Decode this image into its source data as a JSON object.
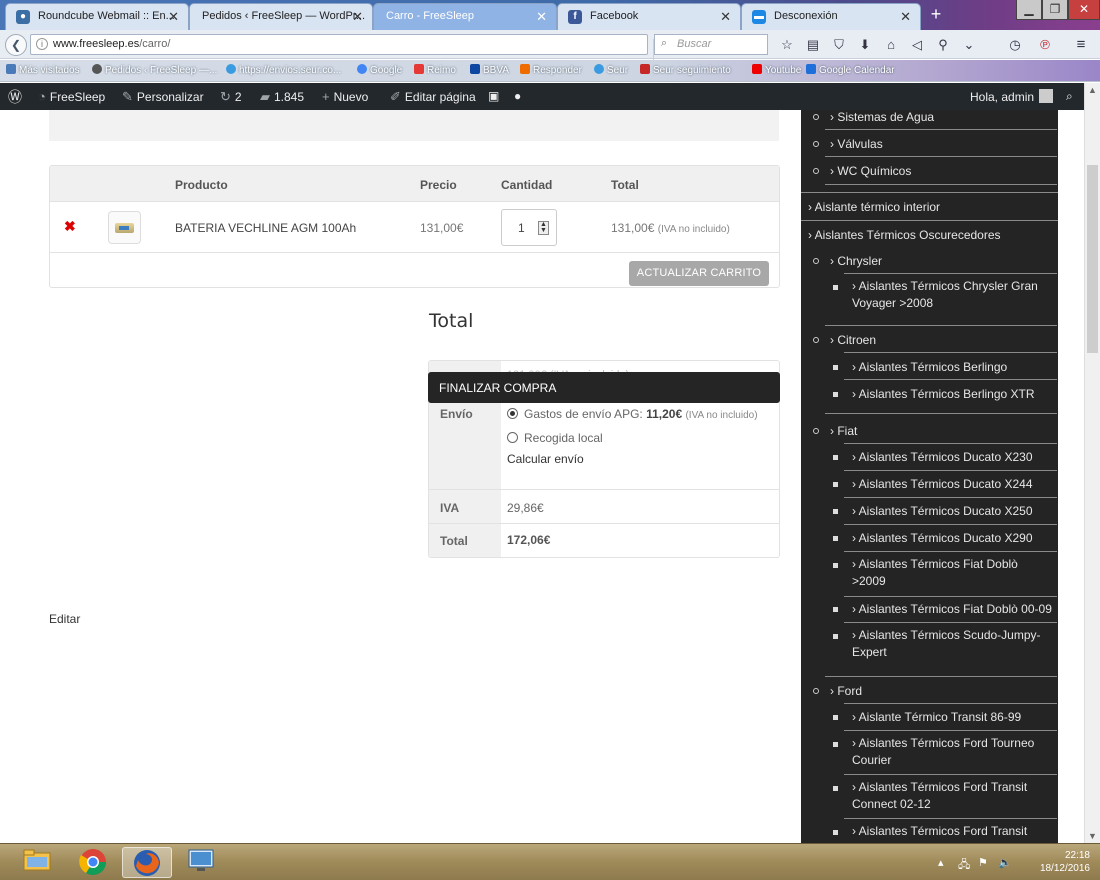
{
  "browser": {
    "tabs": [
      {
        "label": "Roundcube Webmail :: En...",
        "active": false,
        "icon": "globe-icon"
      },
      {
        "label": "Pedidos ‹ FreeSleep — WordPr...",
        "active": false,
        "icon": "none"
      },
      {
        "label": "Carro - FreeSleep",
        "active": true,
        "icon": "none"
      },
      {
        "label": "Facebook",
        "active": false,
        "icon": "facebook-icon"
      },
      {
        "label": "Desconexión",
        "active": false,
        "icon": "window-icon"
      }
    ],
    "new_tab": "+",
    "url_domain": "www.freesleep.es",
    "url_path": "/carro/",
    "search_placeholder": "Buscar",
    "bookmarks": [
      "Más visitados",
      "Pedidos ‹ FreeSleep —...",
      "https://envios.seur.co...",
      "Google",
      "Reimo",
      "BBVA",
      "Responder",
      "Seur",
      "Seur seguimiento",
      "Youtube",
      "Google Calendar"
    ]
  },
  "adminbar": {
    "site": "FreeSleep",
    "customize": "Personalizar",
    "updates": "2",
    "comments": "1.845",
    "new": "Nuevo",
    "edit_page": "Editar página",
    "greeting": "Hola, admin"
  },
  "cart": {
    "headers": {
      "product": "Producto",
      "price": "Precio",
      "quantity": "Cantidad",
      "total": "Total"
    },
    "item": {
      "name": "BATERIA VECHLINE AGM 100Ah",
      "price": "131,00€",
      "quantity": "1",
      "total": "131,00€",
      "total_note": "(IVA no incluido)"
    },
    "update_button": "ACTUALIZAR CARRITO"
  },
  "totals": {
    "title": "Total",
    "subtotal_value": "131,00€ (IVA no incluido)",
    "shipping_label": "Envío",
    "shipping_option_1": "Gastos de envío APG:",
    "shipping_option_1_price": "11,20€",
    "shipping_option_1_note": "(IVA no incluido)",
    "shipping_option_2": "Recogida local",
    "calc_shipping": "Calcular envío",
    "tax_label": "IVA",
    "tax_value": "29,86€",
    "total_label": "Total",
    "total_value": "172,06€",
    "checkout_tooltip": "FINALIZAR COMPRA"
  },
  "page": {
    "edit_link": "Editar"
  },
  "sidebar": {
    "items": [
      "› Sistemas de Agua",
      "› Válvulas",
      "› WC Químicos",
      "› Aislante térmico interior",
      "› Aislantes Térmicos Oscurecedores",
      "› Chrysler",
      "› Aislantes Térmicos Chrysler Gran Voyager >2008",
      "› Citroen",
      "› Aislantes Térmicos Berlingo",
      "› Aislantes Térmicos Berlingo XTR",
      "› Fiat",
      "› Aislantes Térmicos Ducato X230",
      "› Aislantes Térmicos Ducato X244",
      "› Aislantes Térmicos Ducato X250",
      "› Aislantes Térmicos Ducato X290",
      "› Aislantes Térmicos Fiat Doblò >2009",
      "› Aislantes Térmicos Fiat Doblò 00-09",
      "› Aislantes Térmicos Scudo-Jumpy-Expert",
      "› Ford",
      "› Aislante Térmico Transit 86-99",
      "› Aislantes Térmicos Ford Tourneo Courier",
      "› Aislantes Térmicos Ford Transit Connect 02-12",
      "› Aislantes Térmicos Ford Transit"
    ]
  },
  "taskbar": {
    "time": "22:18",
    "date": "18/12/2016"
  },
  "colors": {
    "admin_bar": "#23282d",
    "sidebar": "#242424",
    "remove": "#dd0000",
    "update_button": "#a8a8a8"
  }
}
